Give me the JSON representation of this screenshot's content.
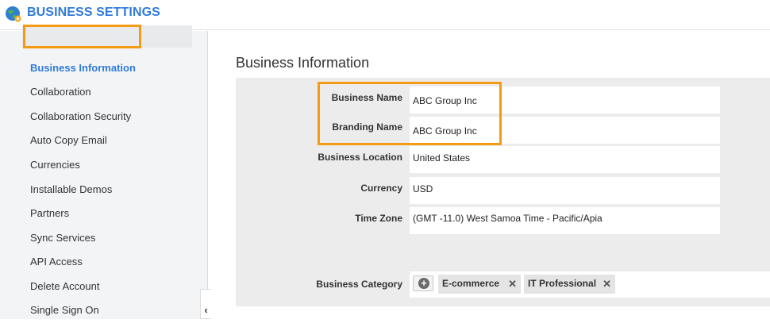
{
  "header": {
    "title": "BUSINESS SETTINGS",
    "logo_icon": "globe-gear-icon"
  },
  "sidebar": {
    "items": [
      {
        "label": "Business Information",
        "active": true
      },
      {
        "label": "Collaboration"
      },
      {
        "label": "Collaboration Security"
      },
      {
        "label": "Auto Copy Email"
      },
      {
        "label": "Currencies"
      },
      {
        "label": "Installable Demos"
      },
      {
        "label": "Partners"
      },
      {
        "label": "Sync Services"
      },
      {
        "label": "API Access"
      },
      {
        "label": "Delete Account"
      },
      {
        "label": "Single Sign On"
      }
    ],
    "collapse_icon": "chevron-left-icon",
    "collapse_glyph": "‹"
  },
  "main": {
    "title": "Business Information",
    "fields": [
      {
        "label": "Business Name",
        "value": "ABC Group Inc"
      },
      {
        "label": "Branding Name",
        "value": "ABC Group Inc"
      },
      {
        "label": "Business Location",
        "value": "United States"
      },
      {
        "label": "Currency",
        "value": "USD"
      },
      {
        "label": "Time Zone",
        "value": "(GMT -11.0) West Samoa Time - Pacific/Apia"
      }
    ],
    "category": {
      "label": "Business Category",
      "add_glyph": "+",
      "remove_glyph": "✕",
      "tags": [
        "E-commerce",
        "IT Professional"
      ]
    }
  },
  "colors": {
    "accent": "#2f7bd9",
    "highlight": "#f59a14"
  }
}
